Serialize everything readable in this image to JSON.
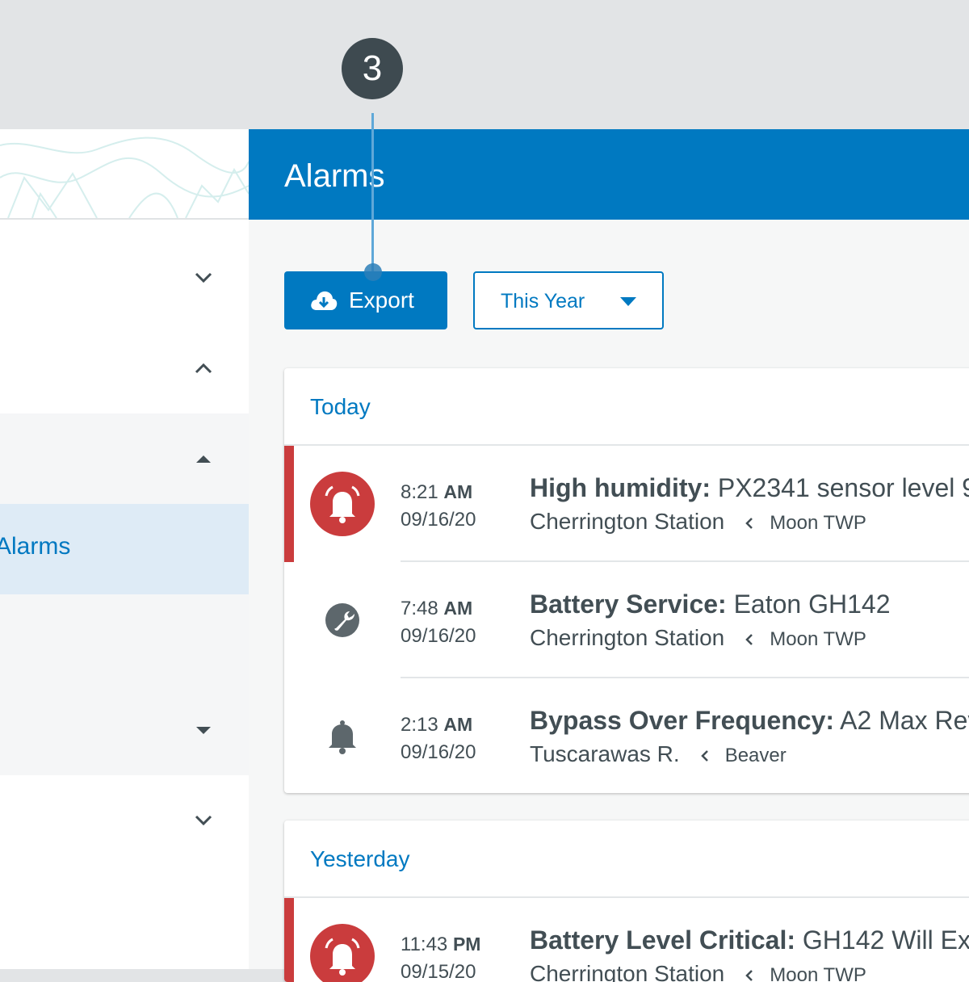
{
  "main": {
    "title": "Alarms",
    "toolbar": {
      "export_label": "Export",
      "range_select": {
        "value": "This Year"
      }
    }
  },
  "sidebar": {
    "items": [
      {
        "chevron": "chevron-down-icon"
      },
      {
        "chevron": "chevron-up-icon"
      },
      {
        "chevron": "caret-up-icon"
      },
      {
        "label": "Alarms",
        "active": true
      },
      {
        "chevron": "caret-down-icon"
      },
      {
        "chevron": "chevron-down-icon"
      }
    ]
  },
  "groups": [
    {
      "title": "Today",
      "rows": [
        {
          "severity": "critical",
          "icon": "alarm-bell-icon",
          "time": "8:21",
          "ampm": "AM",
          "date": "09/16/20",
          "type": "High humidity:",
          "detail": "PX2341 sensor level 9",
          "station": "Cherrington Station",
          "region": "Moon TWP"
        },
        {
          "severity": "service",
          "icon": "wrench-icon",
          "time": "7:48",
          "ampm": "AM",
          "date": "09/16/20",
          "type": "Battery Service:",
          "detail": "Eaton GH142",
          "station": "Cherrington Station",
          "region": "Moon TWP"
        },
        {
          "severity": "info",
          "icon": "bell-icon",
          "time": "2:13",
          "ampm": "AM",
          "date": "09/16/20",
          "type": "Bypass Over Frequency:",
          "detail": "A2 Max Rev",
          "station": "Tuscarawas R.",
          "region": "Beaver"
        }
      ]
    },
    {
      "title": "Yesterday",
      "rows": [
        {
          "severity": "critical",
          "icon": "alarm-bell-icon",
          "time": "11:43",
          "ampm": "PM",
          "date": "09/15/20",
          "type": "Battery Level Critical:",
          "detail": "GH142 Will Ex",
          "station": "Cherrington Station",
          "region": "Moon TWP"
        }
      ]
    }
  ],
  "callout": {
    "number": "3"
  },
  "colors": {
    "brand": "#0079c1",
    "critical": "#ca3c3d",
    "text": "#424e54"
  }
}
